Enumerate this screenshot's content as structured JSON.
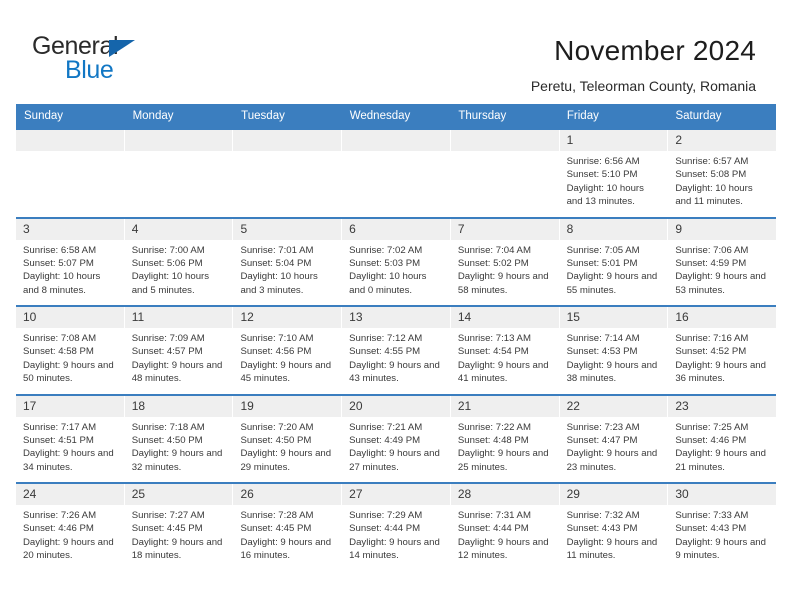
{
  "brand": {
    "name_top": "General",
    "name_bottom": "Blue",
    "triangle_color": "#1565ab",
    "blue_color": "#1277c4"
  },
  "header": {
    "title": "November 2024",
    "subtitle": "Peretu, Teleorman County, Romania"
  },
  "theme": {
    "header_blue": "#3b7ebf",
    "daynum_background": "#efefef",
    "text_color": "#3a3a3a"
  },
  "weekdays": [
    "Sunday",
    "Monday",
    "Tuesday",
    "Wednesday",
    "Thursday",
    "Friday",
    "Saturday"
  ],
  "weeks": [
    [
      {
        "day": "",
        "empty": true
      },
      {
        "day": "",
        "empty": true
      },
      {
        "day": "",
        "empty": true
      },
      {
        "day": "",
        "empty": true
      },
      {
        "day": "",
        "empty": true
      },
      {
        "day": "1",
        "sunrise": "Sunrise: 6:56 AM",
        "sunset": "Sunset: 5:10 PM",
        "daylight": "Daylight: 10 hours and 13 minutes."
      },
      {
        "day": "2",
        "sunrise": "Sunrise: 6:57 AM",
        "sunset": "Sunset: 5:08 PM",
        "daylight": "Daylight: 10 hours and 11 minutes."
      }
    ],
    [
      {
        "day": "3",
        "sunrise": "Sunrise: 6:58 AM",
        "sunset": "Sunset: 5:07 PM",
        "daylight": "Daylight: 10 hours and 8 minutes."
      },
      {
        "day": "4",
        "sunrise": "Sunrise: 7:00 AM",
        "sunset": "Sunset: 5:06 PM",
        "daylight": "Daylight: 10 hours and 5 minutes."
      },
      {
        "day": "5",
        "sunrise": "Sunrise: 7:01 AM",
        "sunset": "Sunset: 5:04 PM",
        "daylight": "Daylight: 10 hours and 3 minutes."
      },
      {
        "day": "6",
        "sunrise": "Sunrise: 7:02 AM",
        "sunset": "Sunset: 5:03 PM",
        "daylight": "Daylight: 10 hours and 0 minutes."
      },
      {
        "day": "7",
        "sunrise": "Sunrise: 7:04 AM",
        "sunset": "Sunset: 5:02 PM",
        "daylight": "Daylight: 9 hours and 58 minutes."
      },
      {
        "day": "8",
        "sunrise": "Sunrise: 7:05 AM",
        "sunset": "Sunset: 5:01 PM",
        "daylight": "Daylight: 9 hours and 55 minutes."
      },
      {
        "day": "9",
        "sunrise": "Sunrise: 7:06 AM",
        "sunset": "Sunset: 4:59 PM",
        "daylight": "Daylight: 9 hours and 53 minutes."
      }
    ],
    [
      {
        "day": "10",
        "sunrise": "Sunrise: 7:08 AM",
        "sunset": "Sunset: 4:58 PM",
        "daylight": "Daylight: 9 hours and 50 minutes."
      },
      {
        "day": "11",
        "sunrise": "Sunrise: 7:09 AM",
        "sunset": "Sunset: 4:57 PM",
        "daylight": "Daylight: 9 hours and 48 minutes."
      },
      {
        "day": "12",
        "sunrise": "Sunrise: 7:10 AM",
        "sunset": "Sunset: 4:56 PM",
        "daylight": "Daylight: 9 hours and 45 minutes."
      },
      {
        "day": "13",
        "sunrise": "Sunrise: 7:12 AM",
        "sunset": "Sunset: 4:55 PM",
        "daylight": "Daylight: 9 hours and 43 minutes."
      },
      {
        "day": "14",
        "sunrise": "Sunrise: 7:13 AM",
        "sunset": "Sunset: 4:54 PM",
        "daylight": "Daylight: 9 hours and 41 minutes."
      },
      {
        "day": "15",
        "sunrise": "Sunrise: 7:14 AM",
        "sunset": "Sunset: 4:53 PM",
        "daylight": "Daylight: 9 hours and 38 minutes."
      },
      {
        "day": "16",
        "sunrise": "Sunrise: 7:16 AM",
        "sunset": "Sunset: 4:52 PM",
        "daylight": "Daylight: 9 hours and 36 minutes."
      }
    ],
    [
      {
        "day": "17",
        "sunrise": "Sunrise: 7:17 AM",
        "sunset": "Sunset: 4:51 PM",
        "daylight": "Daylight: 9 hours and 34 minutes."
      },
      {
        "day": "18",
        "sunrise": "Sunrise: 7:18 AM",
        "sunset": "Sunset: 4:50 PM",
        "daylight": "Daylight: 9 hours and 32 minutes."
      },
      {
        "day": "19",
        "sunrise": "Sunrise: 7:20 AM",
        "sunset": "Sunset: 4:50 PM",
        "daylight": "Daylight: 9 hours and 29 minutes."
      },
      {
        "day": "20",
        "sunrise": "Sunrise: 7:21 AM",
        "sunset": "Sunset: 4:49 PM",
        "daylight": "Daylight: 9 hours and 27 minutes."
      },
      {
        "day": "21",
        "sunrise": "Sunrise: 7:22 AM",
        "sunset": "Sunset: 4:48 PM",
        "daylight": "Daylight: 9 hours and 25 minutes."
      },
      {
        "day": "22",
        "sunrise": "Sunrise: 7:23 AM",
        "sunset": "Sunset: 4:47 PM",
        "daylight": "Daylight: 9 hours and 23 minutes."
      },
      {
        "day": "23",
        "sunrise": "Sunrise: 7:25 AM",
        "sunset": "Sunset: 4:46 PM",
        "daylight": "Daylight: 9 hours and 21 minutes."
      }
    ],
    [
      {
        "day": "24",
        "sunrise": "Sunrise: 7:26 AM",
        "sunset": "Sunset: 4:46 PM",
        "daylight": "Daylight: 9 hours and 20 minutes."
      },
      {
        "day": "25",
        "sunrise": "Sunrise: 7:27 AM",
        "sunset": "Sunset: 4:45 PM",
        "daylight": "Daylight: 9 hours and 18 minutes."
      },
      {
        "day": "26",
        "sunrise": "Sunrise: 7:28 AM",
        "sunset": "Sunset: 4:45 PM",
        "daylight": "Daylight: 9 hours and 16 minutes."
      },
      {
        "day": "27",
        "sunrise": "Sunrise: 7:29 AM",
        "sunset": "Sunset: 4:44 PM",
        "daylight": "Daylight: 9 hours and 14 minutes."
      },
      {
        "day": "28",
        "sunrise": "Sunrise: 7:31 AM",
        "sunset": "Sunset: 4:44 PM",
        "daylight": "Daylight: 9 hours and 12 minutes."
      },
      {
        "day": "29",
        "sunrise": "Sunrise: 7:32 AM",
        "sunset": "Sunset: 4:43 PM",
        "daylight": "Daylight: 9 hours and 11 minutes."
      },
      {
        "day": "30",
        "sunrise": "Sunrise: 7:33 AM",
        "sunset": "Sunset: 4:43 PM",
        "daylight": "Daylight: 9 hours and 9 minutes."
      }
    ]
  ]
}
